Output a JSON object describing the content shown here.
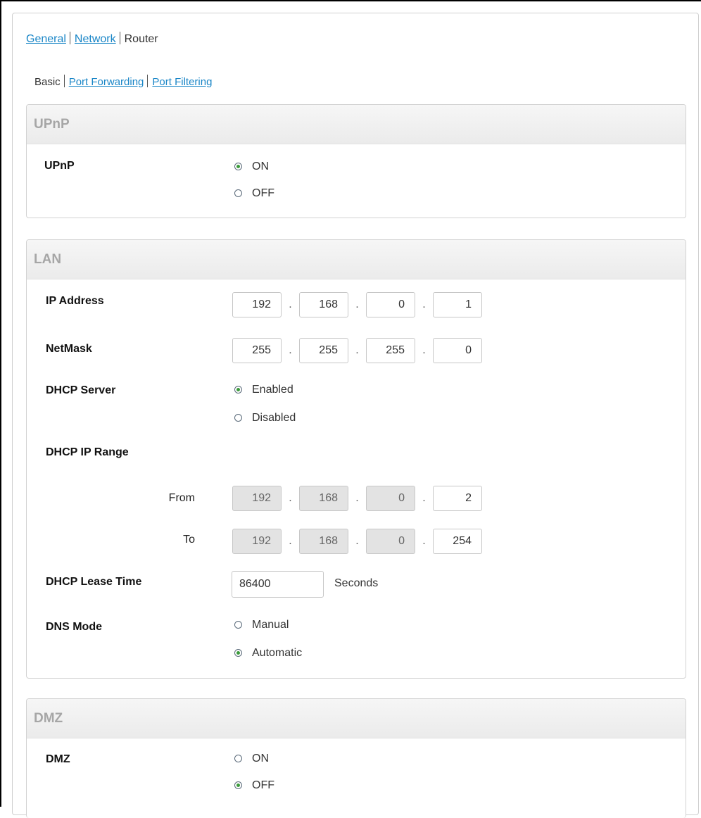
{
  "nav": {
    "main_tabs": [
      {
        "label": "General"
      },
      {
        "label": "Network"
      },
      {
        "label": "Router"
      }
    ],
    "sub_tabs": [
      {
        "label": "Basic"
      },
      {
        "label": "Port Forwarding"
      },
      {
        "label": "Port Filtering"
      }
    ]
  },
  "upnp": {
    "title": "UPnP",
    "label": "UPnP",
    "options": [
      "ON",
      "OFF"
    ],
    "selected": "ON"
  },
  "lan": {
    "title": "LAN",
    "ip_address": {
      "label": "IP Address",
      "octets": [
        "192",
        "168",
        "0",
        "1"
      ]
    },
    "netmask": {
      "label": "NetMask",
      "octets": [
        "255",
        "255",
        "255",
        "0"
      ]
    },
    "dhcp_server": {
      "label": "DHCP Server",
      "options": [
        "Enabled",
        "Disabled"
      ],
      "selected": "Enabled"
    },
    "dhcp_range": {
      "label": "DHCP IP Range",
      "from": {
        "label": "From",
        "octets": [
          "192",
          "168",
          "0",
          "2"
        ]
      },
      "to": {
        "label": "To",
        "octets": [
          "192",
          "168",
          "0",
          "254"
        ]
      }
    },
    "lease": {
      "label": "DHCP Lease Time",
      "value": "86400",
      "unit": "Seconds"
    },
    "dns_mode": {
      "label": "DNS Mode",
      "options": [
        "Manual",
        "Automatic"
      ],
      "selected": "Automatic"
    }
  },
  "dmz": {
    "title": "DMZ",
    "label": "DMZ",
    "options": [
      "ON",
      "OFF"
    ],
    "selected": "OFF"
  }
}
